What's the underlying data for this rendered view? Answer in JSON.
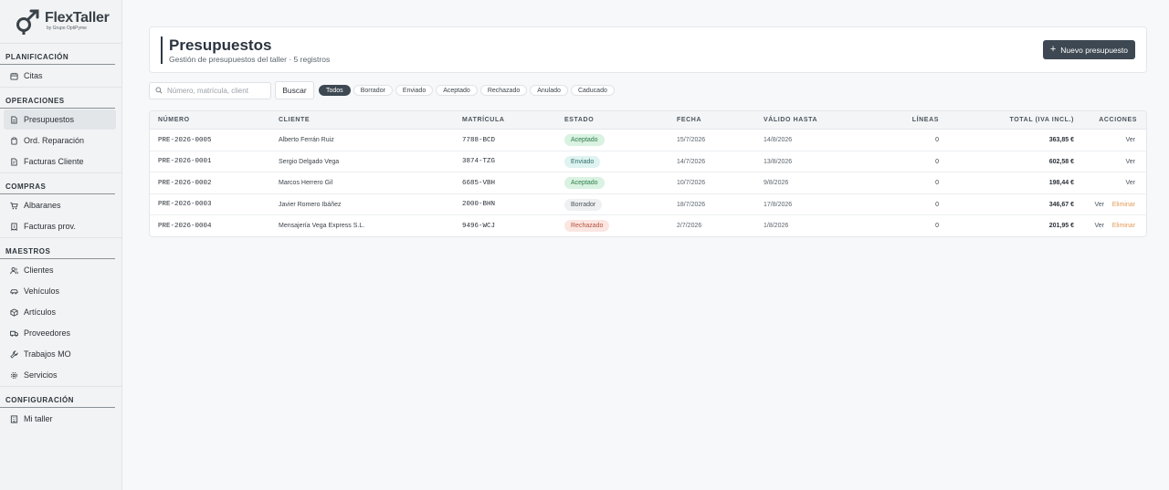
{
  "brand": {
    "name": "FlexTaller",
    "tagline": "by Grupo OptiPyme"
  },
  "sidebar": {
    "sections": [
      {
        "title": "PLANIFICACIÓN",
        "items": [
          {
            "label": "Citas",
            "icon": "calendar-icon"
          }
        ]
      },
      {
        "title": "OPERACIONES",
        "items": [
          {
            "label": "Presupuestos",
            "icon": "file-icon",
            "active": true
          },
          {
            "label": "Ord. Reparación",
            "icon": "clipboard-icon"
          },
          {
            "label": "Facturas Cliente",
            "icon": "invoice-icon"
          }
        ]
      },
      {
        "title": "COMPRAS",
        "items": [
          {
            "label": "Albaranes",
            "icon": "cart-icon"
          },
          {
            "label": "Facturas prov.",
            "icon": "receipt-icon"
          }
        ]
      },
      {
        "title": "MAESTROS",
        "items": [
          {
            "label": "Clientes",
            "icon": "users-icon"
          },
          {
            "label": "Vehículos",
            "icon": "car-icon"
          },
          {
            "label": "Artículos",
            "icon": "package-icon"
          },
          {
            "label": "Proveedores",
            "icon": "truck-icon"
          },
          {
            "label": "Trabajos MO",
            "icon": "wrench-icon"
          },
          {
            "label": "Servicios",
            "icon": "gear-icon"
          }
        ]
      },
      {
        "title": "CONFIGURACIÓN",
        "items": [
          {
            "label": "Mi taller",
            "icon": "building-icon"
          }
        ]
      }
    ]
  },
  "header": {
    "title": "Presupuestos",
    "subtitle": "Gestión de presupuestos del taller · 5 registros",
    "new_button": "Nuevo presupuesto"
  },
  "filters": {
    "search_placeholder": "Número, matrícula, client",
    "search_button": "Buscar",
    "chips": [
      "Todos",
      "Borrador",
      "Enviado",
      "Aceptado",
      "Rechazado",
      "Anulado",
      "Caducado"
    ],
    "active_chip": "Todos"
  },
  "table": {
    "columns": [
      "NÚMERO",
      "CLIENTE",
      "MATRÍCULA",
      "ESTADO",
      "FECHA",
      "VÁLIDO HASTA",
      "LÍNEAS",
      "TOTAL (IVA INCL.)",
      "ACCIONES"
    ],
    "rows": [
      {
        "numero": "PRE-2026-0005",
        "cliente": "Alberto Ferrán Ruiz",
        "matricula": "7788-BCD",
        "estado": "Aceptado",
        "fecha": "15/7/2026",
        "valido": "14/8/2026",
        "lineas": "0",
        "total": "363,85 €",
        "actions": [
          "Ver"
        ]
      },
      {
        "numero": "PRE-2026-0001",
        "cliente": "Sergio Delgado Vega",
        "matricula": "3874-TZG",
        "estado": "Enviado",
        "fecha": "14/7/2026",
        "valido": "13/8/2026",
        "lineas": "0",
        "total": "602,58 €",
        "actions": [
          "Ver"
        ]
      },
      {
        "numero": "PRE-2026-0002",
        "cliente": "Marcos Herrero Gil",
        "matricula": "6685-VBH",
        "estado": "Aceptado",
        "fecha": "10/7/2026",
        "valido": "9/8/2026",
        "lineas": "0",
        "total": "198,44 €",
        "actions": [
          "Ver"
        ]
      },
      {
        "numero": "PRE-2026-0003",
        "cliente": "Javier Romero Ibáñez",
        "matricula": "2000-BHN",
        "estado": "Borrador",
        "fecha": "18/7/2026",
        "valido": "17/8/2026",
        "lineas": "0",
        "total": "346,67 €",
        "actions": [
          "Ver",
          "Eliminar"
        ]
      },
      {
        "numero": "PRE-2026-0004",
        "cliente": "Mensajería Vega Express S.L.",
        "matricula": "9496-WCJ",
        "estado": "Rechazado",
        "fecha": "2/7/2026",
        "valido": "1/8/2026",
        "lineas": "0",
        "total": "201,95 €",
        "actions": [
          "Ver",
          "Eliminar"
        ]
      }
    ]
  },
  "status_colors": {
    "Aceptado": {
      "bg": "#d9f2e1",
      "fg": "#2e7d4b"
    },
    "Enviado": {
      "bg": "#dff3f1",
      "fg": "#2d6f6a"
    },
    "Borrador": {
      "bg": "#eef0f2",
      "fg": "#4b545c"
    },
    "Rechazado": {
      "bg": "#fbe6e2",
      "fg": "#b5523e"
    }
  }
}
